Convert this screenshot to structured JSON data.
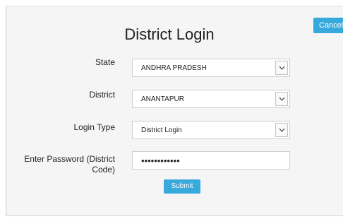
{
  "header": {
    "title": "District Login",
    "cancel_label": "Cancel"
  },
  "form": {
    "state": {
      "label": "State",
      "value": "ANDHRA PRADESH"
    },
    "district": {
      "label": "District",
      "value": "ANANTAPUR"
    },
    "login_type": {
      "label": "Login Type",
      "value": "District Login"
    },
    "password": {
      "label_line1": "Enter Password (District",
      "label_line2": "Code)",
      "value": "••••••••••••"
    },
    "submit_label": "Submit"
  },
  "icons": {
    "dropdown": "chevron-down-icon"
  },
  "colors": {
    "button_bg": "#37a9dc",
    "panel_bg": "#f5f5f5"
  }
}
